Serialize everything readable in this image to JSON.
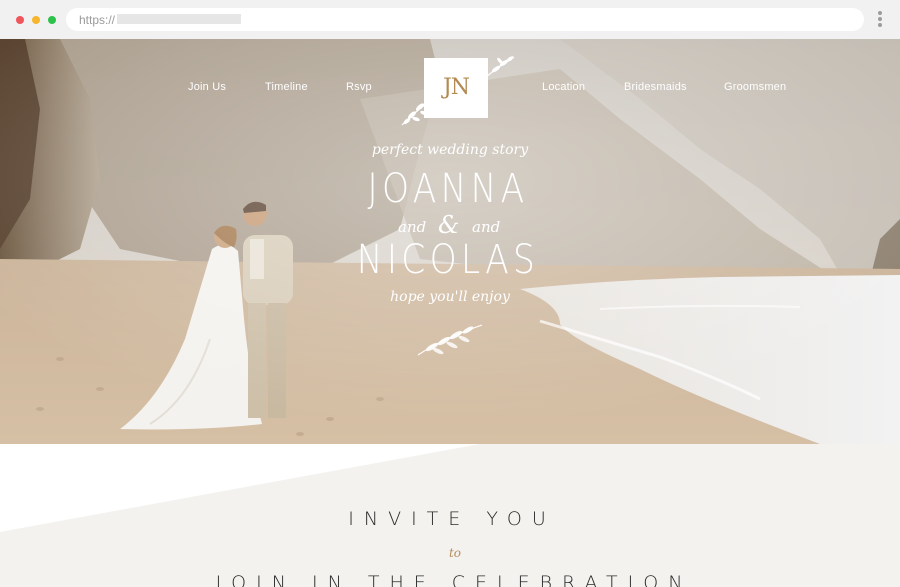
{
  "browser": {
    "url_prefix": "https://",
    "icons": [
      "close-dot",
      "minimize-dot",
      "maximize-dot",
      "kebab-menu-icon"
    ]
  },
  "nav": {
    "items_left": [
      "Join Us",
      "Timeline",
      "Rsvp"
    ],
    "items_right": [
      "Location",
      "Bridesmaids",
      "Groomsmen"
    ],
    "logo": "JN"
  },
  "hero": {
    "tagline_top": "perfect wedding story",
    "name_first": "JOANNA",
    "and_left": "and",
    "ampersand": "&",
    "and_right": "and",
    "name_second": "NICOLAS",
    "tagline_bottom": "hope you'll enjoy"
  },
  "section": {
    "invite": "INVITE YOU",
    "to": "to",
    "join": "JOIN IN THE CELEBRATION"
  },
  "colors": {
    "accent_gold": "#b38a52",
    "text_dark": "#2a2a2a",
    "section_bg": "#f3f2ef"
  }
}
